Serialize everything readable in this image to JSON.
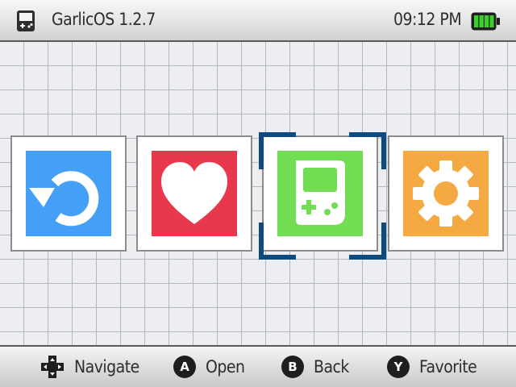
{
  "header": {
    "title": "GarlicOS 1.2.7",
    "time": "09:12 PM",
    "battery_level": 1.0,
    "logo_icon": "handheld-console-icon",
    "battery_icon": "battery-full-icon"
  },
  "menu": {
    "items": [
      {
        "id": "resume",
        "icon": "resume-arrow-icon",
        "color": "#44a0f6"
      },
      {
        "id": "favorites",
        "icon": "heart-icon",
        "color": "#e8384c"
      },
      {
        "id": "games",
        "icon": "gameboy-icon",
        "color": "#72dc52",
        "selected": true
      },
      {
        "id": "settings",
        "icon": "gear-icon",
        "color": "#f5a942"
      }
    ]
  },
  "footer": {
    "hints": [
      {
        "button": "",
        "label": "Navigate",
        "icon": "dpad-icon"
      },
      {
        "button": "A",
        "label": "Open",
        "icon": "a-button-icon"
      },
      {
        "button": "B",
        "label": "Back",
        "icon": "b-button-icon"
      },
      {
        "button": "Y",
        "label": "Favorite",
        "icon": "y-button-icon"
      }
    ]
  },
  "colors": {
    "selection_bracket": "#0f4a7e",
    "battery_fill": "#3ad22a"
  }
}
